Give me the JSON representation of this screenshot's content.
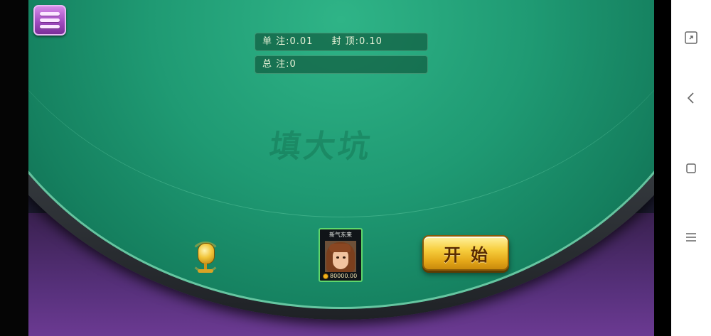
{
  "table": {
    "single_bet": "单 注:0.01",
    "cap": "封 顶:0.10",
    "total_bet": "总 注:0",
    "watermark": "填大坑"
  },
  "player": {
    "name": "新气东来",
    "coins": "80000.00"
  },
  "buttons": {
    "start_label": "开始"
  },
  "icons": {
    "menu": "menu-icon",
    "mic": "microphone-icon",
    "coin": "coin-icon",
    "fullscreen": "fullscreen-icon",
    "back": "back-icon",
    "home": "home-icon",
    "recents": "recents-icon"
  },
  "colors": {
    "felt": "#1f9a73",
    "menu_button": "#a14cc0",
    "start_button": "#f7cf3f",
    "player_border": "#5fd76b"
  }
}
